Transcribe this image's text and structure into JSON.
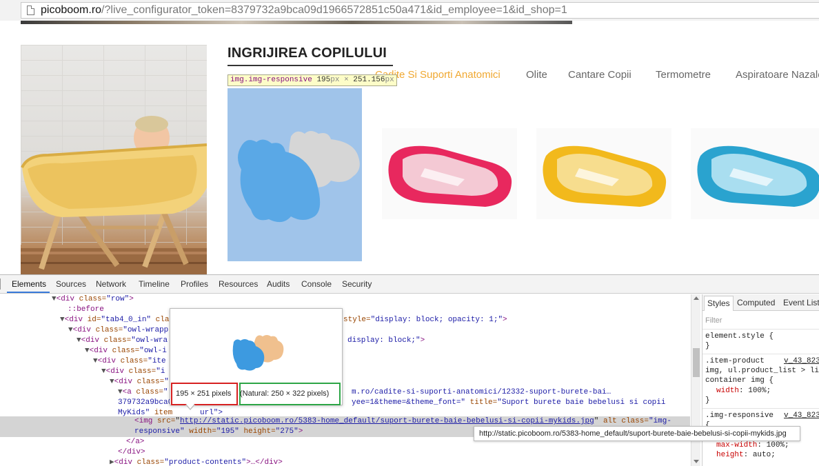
{
  "browser": {
    "url_domain": "picoboom.ro",
    "url_path": "/?live_configurator_token=8379732a9bca09d1966572851c50a471&id_employee=1&id_shop=1"
  },
  "page": {
    "section_title": "INGRIJIREA COPILULUI",
    "tabs": [
      "Cadite Si Suporti Anatomici",
      "Olite",
      "Cantare Copii",
      "Termometre",
      "Aspiratoare Nazale"
    ],
    "active_tab_index": 0,
    "inspect_tooltip": {
      "selector": "img.img-responsive",
      "w": "195",
      "h": "251.156",
      "unit": "px",
      "times": "×"
    },
    "product_colors": [
      "#e8285e",
      "#f2b91c",
      "#2aa3cf"
    ],
    "accent_color": "#f0a830",
    "highlight_color": "#a0c4ea"
  },
  "devtools": {
    "tabs": [
      "Elements",
      "Sources",
      "Network",
      "Timeline",
      "Profiles",
      "Resources",
      "Audits",
      "Console",
      "Security"
    ],
    "active_tab": "Elements",
    "dom": {
      "l1_tag": "<div",
      "l1_attr": " class=",
      "l1_val": "\"row\"",
      "l1_end": ">",
      "l2": "::before",
      "l3_tag": "<div",
      "l3_attr": " id=",
      "l3_val": "\"tab4_0_in\"",
      "l3_attr2": " cla",
      "l3_tail_attr": "style=",
      "l3_tail_val": "\"display: block; opacity: 1;\"",
      "l3_end": ">",
      "l4_tag": "<div",
      "l4_attr": " class=",
      "l4_val": "\"owl-wrapp",
      "l5_tag": "<div",
      "l5_attr": " class=",
      "l5_val": "\"owl-wra",
      "l5_tail_val": "display: block;\"",
      "l5_end": ">",
      "l6_tag": "<div",
      "l6_attr": " class=",
      "l6_val": "\"owl-i",
      "l7_tag": "<div",
      "l7_attr": " class=",
      "l7_val": "\"ite",
      "l8_tag": "<div",
      "l8_attr": " class=",
      "l8_val": "\"i",
      "l9_tag": "<div",
      "l9_attr": " class=",
      "l9_val": "\"",
      "l10_tag": "<a",
      "l10_attr": " class=",
      "l10_val": "\"",
      "l10_tail": "m.ro/cadite-si-suporti-anatomici/12332-suport-burete-bai…",
      "l11_head": "379732a9bca0",
      "l11_tail_val": "yee=1&theme=&theme_font=\"",
      "l11_attr": " title=",
      "l11_title": "\"Suport burete baie bebelusi si copii",
      "l12_val": "MyKids\"",
      "l12_attr": " item",
      "l12_tail": "url\">",
      "img_tag": "<img",
      "img_src_attr": " src=",
      "img_src": "http://static.picoboom.ro/5383-home_default/suport-burete-baie-bebelusi-si-copii-mykids.jpg",
      "img_alt_attr": " alt",
      "img_class_attr": " class=",
      "img_class_val": "\"img-",
      "img_class_val2": "responsive\"",
      "img_w_attr": " width=",
      "img_w_val": "\"195\"",
      "img_h_attr": " height=",
      "img_h_val": "\"275\"",
      "img_end": ">",
      "close_a": "</a>",
      "close_div": "</div>",
      "last_tag": "<div",
      "last_attr": " class=",
      "last_val": "\"product-contents\"",
      "last_end": ">…</div>"
    },
    "image_preview": {
      "rendered": "195 × 251 pixels",
      "natural": "(Natural: 250 × 322 pixels)"
    },
    "url_tooltip": "http://static.picoboom.ro/5383-home_default/suport-burete-baie-bebelusi-si-copii-mykids.jpg",
    "styles_panel": {
      "tabs": [
        "Styles",
        "Computed",
        "Event Listeners"
      ],
      "filter_placeholder": "Filter",
      "element_style": "element.style {",
      "close_brace": "}",
      "rule1_sel1": ".item-product",
      "rule1_src": "v_43_823",
      "rule1_sel2": "img, ul.product_list > li",
      "rule1_sel3": "container img {",
      "rule1_prop": "width",
      "rule1_val": "100%;",
      "rule2_sel": ".img-responsive",
      "rule2_src": "v_43_823",
      "rule2_open": "{",
      "rule2_prop1": "max-width",
      "rule2_val1": "100%;",
      "rule2_prop2": "height",
      "rule2_val2": "auto;"
    }
  }
}
